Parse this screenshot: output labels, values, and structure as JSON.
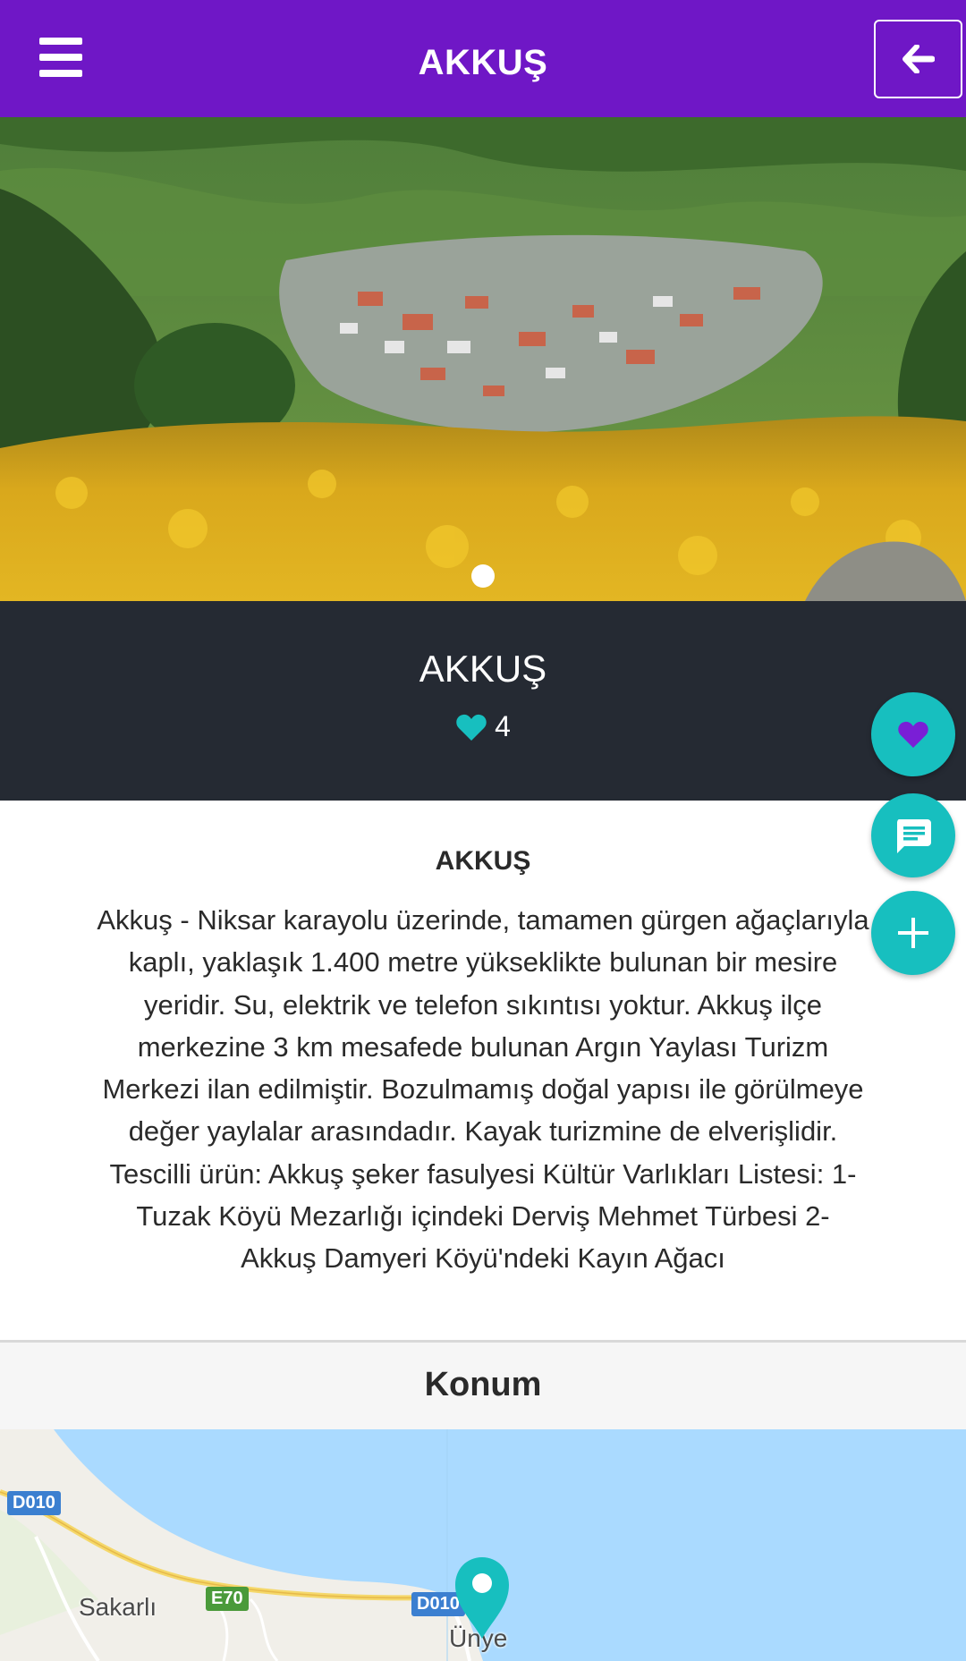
{
  "header": {
    "title": "AKKUŞ",
    "menu_icon": "hamburger-menu-icon",
    "back_icon": "arrow-left-icon"
  },
  "hero": {
    "image_description": "",
    "slide_count": 1,
    "active_slide": 1
  },
  "info": {
    "title": "AKKUŞ",
    "likes": "4"
  },
  "fabs": {
    "favorite_icon": "heart-icon",
    "comment_icon": "comment-icon",
    "add_icon": "plus-icon"
  },
  "description": {
    "title": "AKKUŞ",
    "body": "Akkuş - Niksar karayolu üzerinde, tamamen gürgen ağaçlarıyla\nkaplı, yaklaşık 1.400 metre yükseklikte bulunan bir mesire\nyeridir. Su, elektrik ve telefon sıkıntısı yoktur. Akkuş ilçe\nmerkezine 3 km mesafede bulunan Argın Yaylası Turizm\nMerkezi ilan edilmiştir. Bozulmamış doğal yapısı ile görülmeye\ndeğer yaylalar arasındadır. Kayak turizmine de elverişlidir.\nTescilli ürün: Akkuş şeker fasulyesi   Kültür Varlıkları Listesi: 1-\nTuzak Köyü Mezarlığı içindeki Derviş Mehmet Türbesi  2-\nAkkuş Damyeri Köyü'ndeki Kayın Ağacı"
  },
  "location": {
    "title": "Konum"
  },
  "map": {
    "road_d010_a": "D010",
    "road_e70": "E70",
    "road_d010_b": "D010",
    "place_sakarli": "Sakarlı",
    "place_unye": "Ünye",
    "marker_icon": "map-pin-icon"
  },
  "colors": {
    "header": "#6f17c6",
    "info_band": "#252a33",
    "accent_teal": "#17bfbf",
    "heart_purple": "#7a1fd6"
  }
}
